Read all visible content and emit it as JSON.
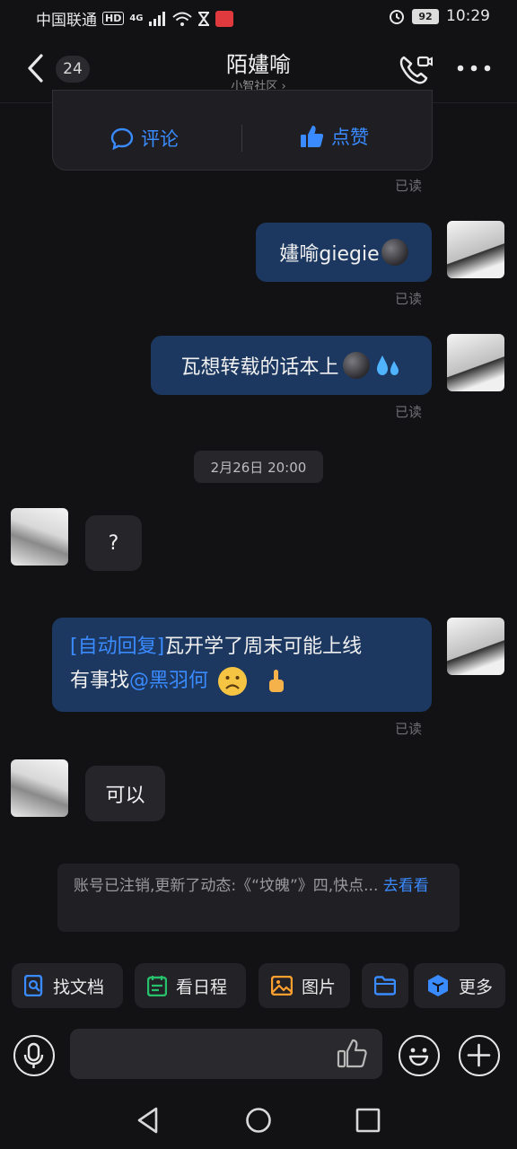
{
  "status_bar": {
    "carrier": "中国联通",
    "hd": "HD",
    "network": "4G",
    "battery": "92",
    "time": "10:29"
  },
  "header": {
    "unread_count": "24",
    "title": "陌嫿喻",
    "subtitle": "小智社区 ›"
  },
  "card": {
    "comment_label": "评论",
    "like_label": "点赞"
  },
  "read_label": "已读",
  "messages": [
    {
      "side": "out",
      "text": "嫿喻giegie"
    },
    {
      "side": "out",
      "text": "瓦想转载的话本上"
    },
    {
      "side": "in",
      "text": "?"
    },
    {
      "side": "out",
      "prefix": "[自动回复]",
      "text": "瓦开学了周末可能上线",
      "line2": "有事找",
      "mention": "@黑羽何"
    },
    {
      "side": "in",
      "text": "可以"
    }
  ],
  "date_divider": "2月26日 20:00",
  "notice": {
    "text": "账号已注销,更新了动态:《“坟魄”》四,快点...",
    "link": "去看看"
  },
  "quick_actions": [
    {
      "label": "找文档",
      "icon": "doc-search-icon",
      "color": "#3a8bff"
    },
    {
      "label": "看日程",
      "icon": "calendar-icon",
      "color": "#27c06b"
    },
    {
      "label": "图片",
      "icon": "image-icon",
      "color": "#ff9f2e"
    },
    {
      "label": "",
      "icon": "folder-icon",
      "color": "#3a8bff"
    },
    {
      "label": "更多",
      "icon": "more-apps-icon",
      "color": "#3a8bff"
    }
  ],
  "input": {
    "placeholder": ""
  }
}
